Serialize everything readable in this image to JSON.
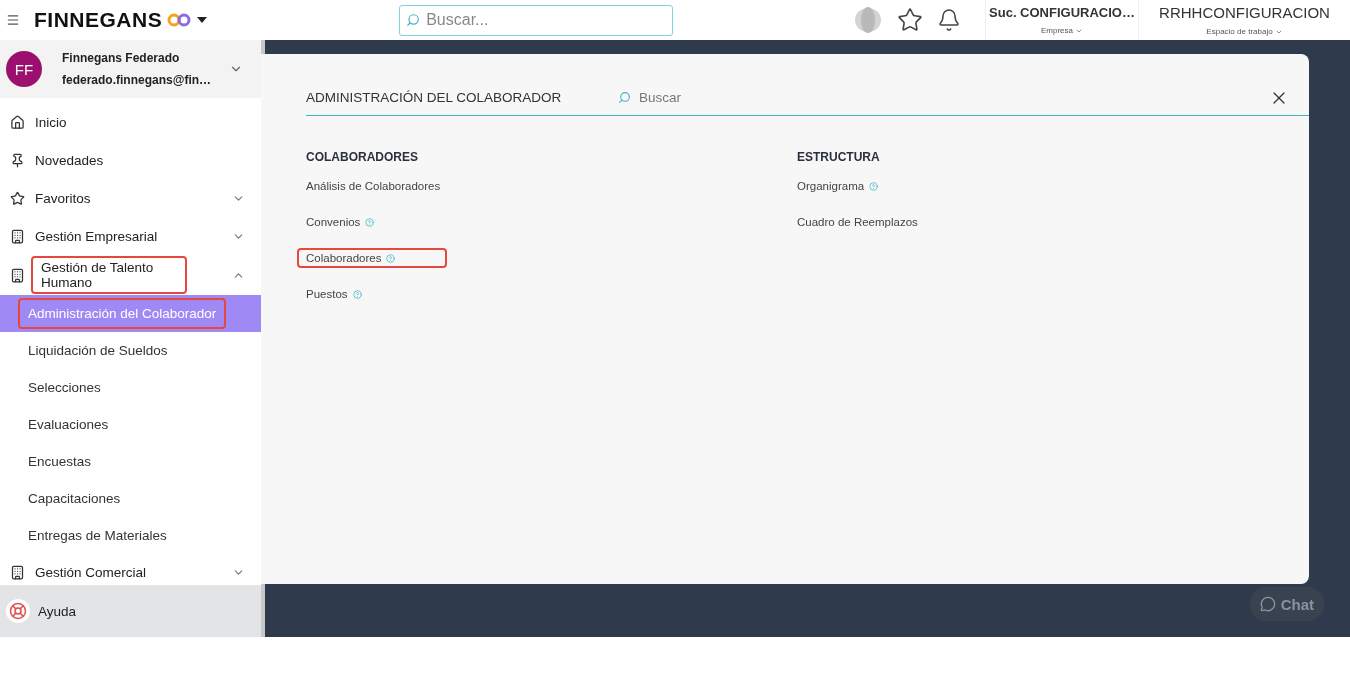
{
  "header": {
    "brand": "FINNEGANS",
    "search_placeholder": "Buscar...",
    "company": {
      "value": "Suc. CONFIGURACIO…",
      "label": "Empresa"
    },
    "workspace": {
      "value": "RRHHCONFIGURACION",
      "label": "Espacio de trabajo"
    }
  },
  "user": {
    "initials": "FF",
    "name": "Finnegans Federado",
    "email": "federado.finnegans@fin…"
  },
  "nav": [
    {
      "label": "Inicio",
      "highlighted": false
    },
    {
      "label": "Novedades",
      "highlighted": false
    },
    {
      "label": "Favoritos",
      "expanded": false,
      "highlighted": false
    },
    {
      "label": "Gestión Empresarial",
      "expanded": false,
      "highlighted": false
    },
    {
      "label": "Gestión de Talento Humano",
      "expanded": true,
      "highlighted": true,
      "children": [
        {
          "label": "Administración del Colaborador",
          "selected": true,
          "highlighted": true
        },
        {
          "label": "Liquidación de Sueldos",
          "selected": false,
          "highlighted": false
        },
        {
          "label": "Selecciones",
          "selected": false,
          "highlighted": false
        },
        {
          "label": "Evaluaciones",
          "selected": false,
          "highlighted": false
        },
        {
          "label": "Encuestas",
          "selected": false,
          "highlighted": false
        },
        {
          "label": "Capacitaciones",
          "selected": false,
          "highlighted": false
        },
        {
          "label": "Entregas de Materiales",
          "selected": false,
          "highlighted": false
        }
      ]
    },
    {
      "label": "Gestión Comercial",
      "expanded": false,
      "highlighted": false
    }
  ],
  "help": "Ayuda",
  "modal": {
    "title": "ADMINISTRACIÓN DEL COLABORADOR",
    "search_placeholder": "Buscar",
    "columns": [
      {
        "heading": "COLABORADORES",
        "links": [
          {
            "label": "Análisis de Colaboradores",
            "help": false,
            "highlighted": false
          },
          {
            "label": "Convenios",
            "help": true,
            "highlighted": false
          },
          {
            "label": "Colaboradores",
            "help": true,
            "highlighted": true
          },
          {
            "label": "Puestos",
            "help": true,
            "highlighted": false
          }
        ]
      },
      {
        "heading": "ESTRUCTURA",
        "links": [
          {
            "label": "Organigrama",
            "help": true,
            "highlighted": false
          },
          {
            "label": "Cuadro de Reemplazos",
            "help": false,
            "highlighted": false
          }
        ]
      }
    ]
  },
  "chat": "Chat"
}
